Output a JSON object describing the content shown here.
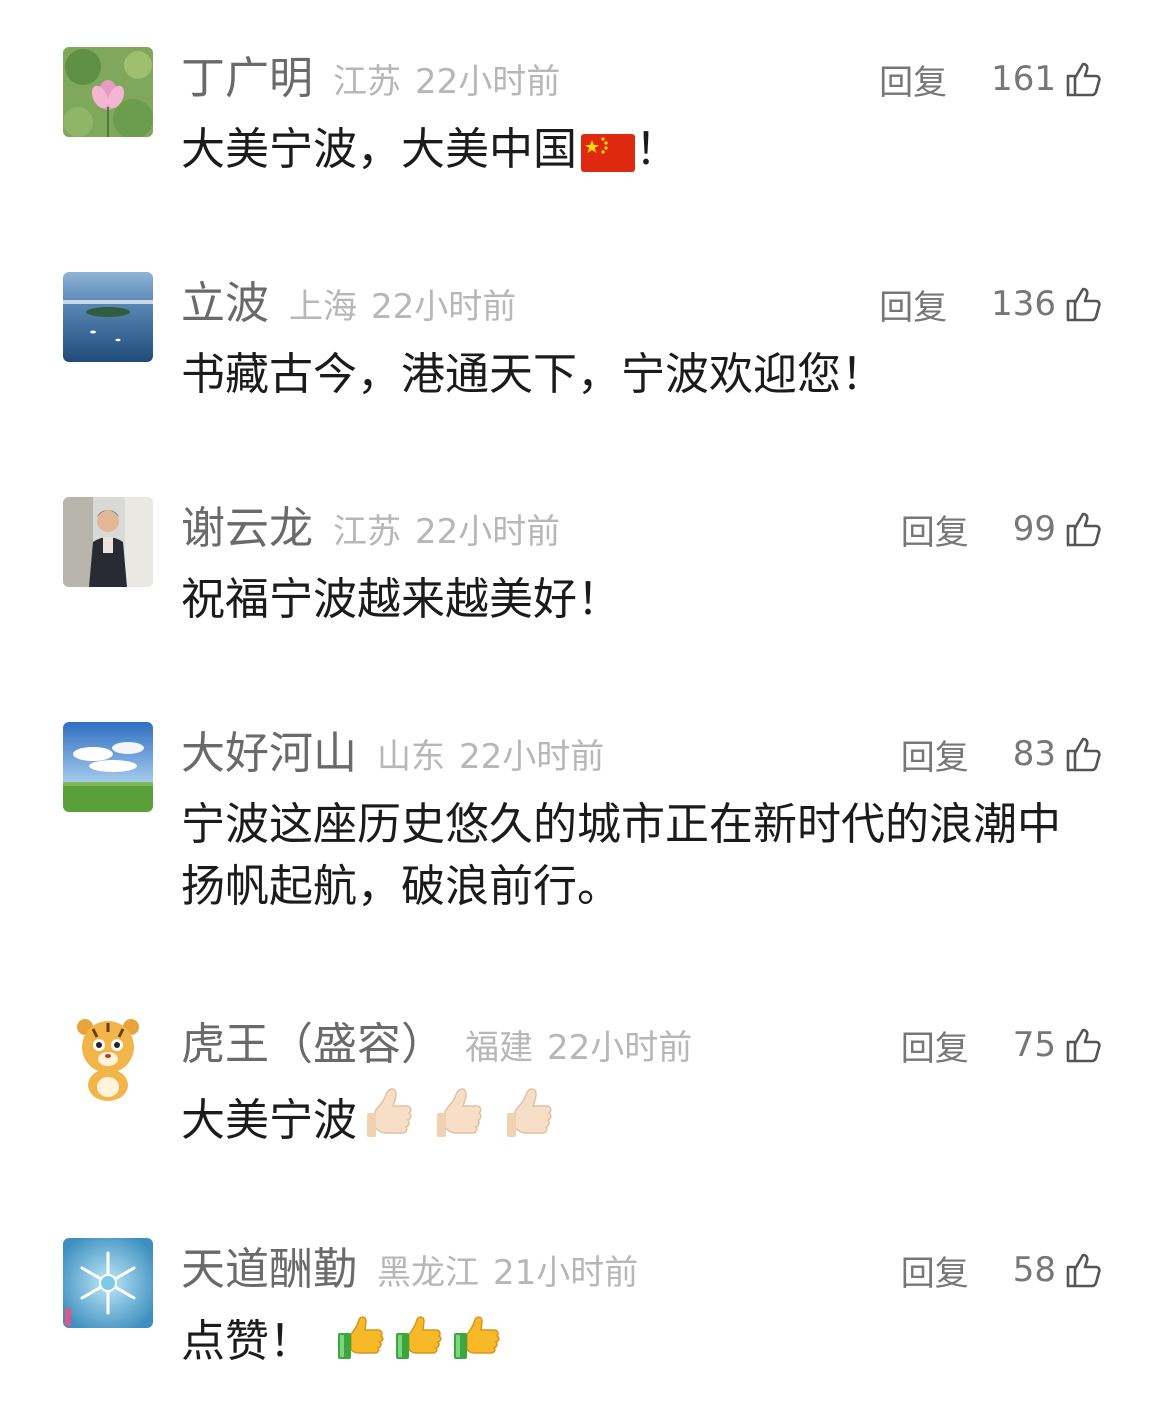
{
  "comments": [
    {
      "name": "丁广明",
      "location": "江苏",
      "time": "22小时前",
      "reply_label": "回复",
      "likes": "161",
      "text": "大美宁波，大美中国",
      "text_suffix": "！",
      "emoji": "china-flag"
    },
    {
      "name": "立波",
      "location": "上海",
      "time": "22小时前",
      "reply_label": "回复",
      "likes": "136",
      "text": "书藏古今，港通天下，宁波欢迎您！"
    },
    {
      "name": "谢云龙",
      "location": "江苏",
      "time": "22小时前",
      "reply_label": "回复",
      "likes": "99",
      "text": "祝福宁波越来越美好！"
    },
    {
      "name": "大好河山",
      "location": "山东",
      "time": "22小时前",
      "reply_label": "回复",
      "likes": "83",
      "text": "宁波这座历史悠久的城市正在新时代的浪潮中扬帆起航，破浪前行。"
    },
    {
      "name": "虎王（盛容）",
      "location": "福建",
      "time": "22小时前",
      "reply_label": "回复",
      "likes": "75",
      "text": "大美宁波",
      "emoji": "thumbs-up-light x3"
    },
    {
      "name": "天道酬勤",
      "location": "黑龙江",
      "time": "21小时前",
      "reply_label": "回复",
      "likes": "58",
      "text": "点赞！",
      "emoji": "thumbs-up-yellow x3"
    }
  ],
  "colors": {
    "name": "#6a6a6a",
    "meta": "#b7b7b7",
    "action": "#777777",
    "text": "#1b1b1b"
  }
}
